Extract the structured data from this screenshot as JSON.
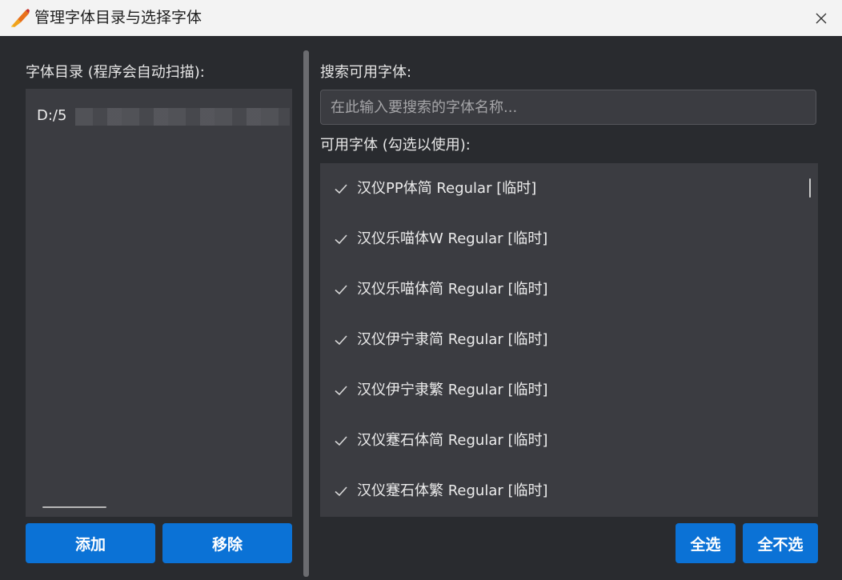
{
  "window": {
    "title": "管理字体目录与选择字体"
  },
  "left": {
    "dir_label": "字体目录 (程序会自动扫描):",
    "directories": [
      "D:/5"
    ],
    "add_label": "添加",
    "remove_label": "移除"
  },
  "right": {
    "search_label": "搜索可用字体:",
    "search_placeholder": "在此输入要搜索的字体名称...",
    "list_label": "可用字体 (勾选以使用):",
    "fonts": [
      {
        "name": "汉仪PP体简 Regular [临时]",
        "checked": true
      },
      {
        "name": "汉仪乐喵体W Regular [临时]",
        "checked": true
      },
      {
        "name": "汉仪乐喵体简 Regular [临时]",
        "checked": true
      },
      {
        "name": "汉仪伊宁隶简 Regular [临时]",
        "checked": true
      },
      {
        "name": "汉仪伊宁隶繁 Regular [临时]",
        "checked": true
      },
      {
        "name": "汉仪蹇石体简 Regular [临时]",
        "checked": true
      },
      {
        "name": "汉仪蹇石体繁 Regular [临时]",
        "checked": true
      }
    ],
    "select_all_label": "全选",
    "select_none_label": "全不选"
  },
  "colors": {
    "accent": "#0b72d6",
    "background": "#292b2f",
    "panel": "#3b3c41",
    "titlebar": "#f3f3f3"
  },
  "icons": {
    "app": "pencil-fire-icon",
    "close": "close-icon",
    "check": "checkmark-icon"
  }
}
